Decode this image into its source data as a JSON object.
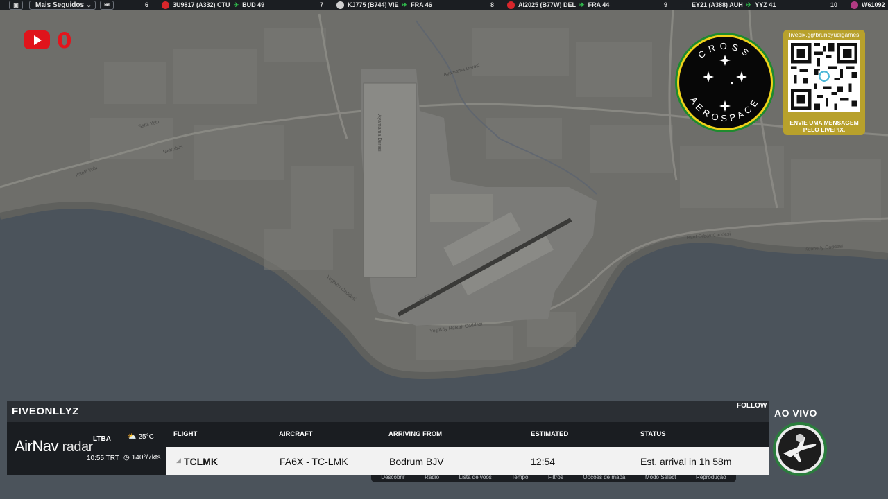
{
  "topbar": {
    "menu_icon": "window-icon",
    "dropdown_label": "Mais Seguidos",
    "skip_icon": "skip-forward-icon",
    "ticker": [
      {
        "num": "6",
        "text": "3U9817 (A332) CTU",
        "dest": "BUD 49",
        "logo_color": "#d8262b"
      },
      {
        "num": "7",
        "text": "KJ775 (B744) VIE",
        "dest": "FRA 46",
        "logo_color": "#d0d0d0"
      },
      {
        "num": "8",
        "text": "AI2025 (B77W) DEL",
        "dest": "FRA 44",
        "logo_color": "#d8262b"
      },
      {
        "num": "9",
        "text": "EY21 (A388) AUH",
        "dest": "YYZ 41",
        "logo_color": "#1b1e22"
      },
      {
        "num": "10",
        "text": "W61092",
        "dest": "",
        "logo_color": "#b03a82"
      }
    ]
  },
  "youtube": {
    "count": "0"
  },
  "cross_logo": {
    "text_top": "CROSS",
    "text_bottom": "AEROSPACE"
  },
  "qr": {
    "url": "livepix.gg/brunoyudigames",
    "caption_line1": "ENVIE UMA MENSAGEM",
    "caption_line2": "PELO LIVEPIX."
  },
  "map": {
    "labels": {
      "road1": "Sahil Yolu",
      "road2": "Metrobüs",
      "road3": "İkitelli Yolu",
      "airport_runway": "05/23",
      "stream": "Ayamama Deresi",
      "coast_road": "Yeşilköy Halkalı Caddesi",
      "road4": "Rauf Orbay Caddesi",
      "road5": "Kennedy Caddesi",
      "road6": "Yeşilköy Caddesi"
    }
  },
  "panel": {
    "callsign": "FIVEONLLYZ",
    "follow_label": "FOLLOW",
    "brand": "AirNav",
    "brand_suffix": "radar",
    "airport_code": "LTBA",
    "airport_time": "10:55 TRT",
    "temperature": "25°C",
    "wind": "140°/7kts",
    "headers": {
      "flight": "FLIGHT",
      "aircraft": "AIRCRAFT",
      "arriving_from": "ARRIVING FROM",
      "estimated": "ESTIMATED",
      "status": "STATUS"
    },
    "row": {
      "flight": "TCLMK",
      "aircraft": "FA6X - TC-LMK",
      "arriving_from": "Bodrum BJV",
      "estimated": "12:54",
      "status": "Est. arrival in 1h 58m"
    }
  },
  "map_controls": [
    "Descobrir",
    "Radio",
    "Lista de voos",
    "Tempo",
    "Filtros",
    "Opções de mapa",
    "Modo Select",
    "Reprodução"
  ],
  "live": {
    "label": "AO VIVO"
  }
}
